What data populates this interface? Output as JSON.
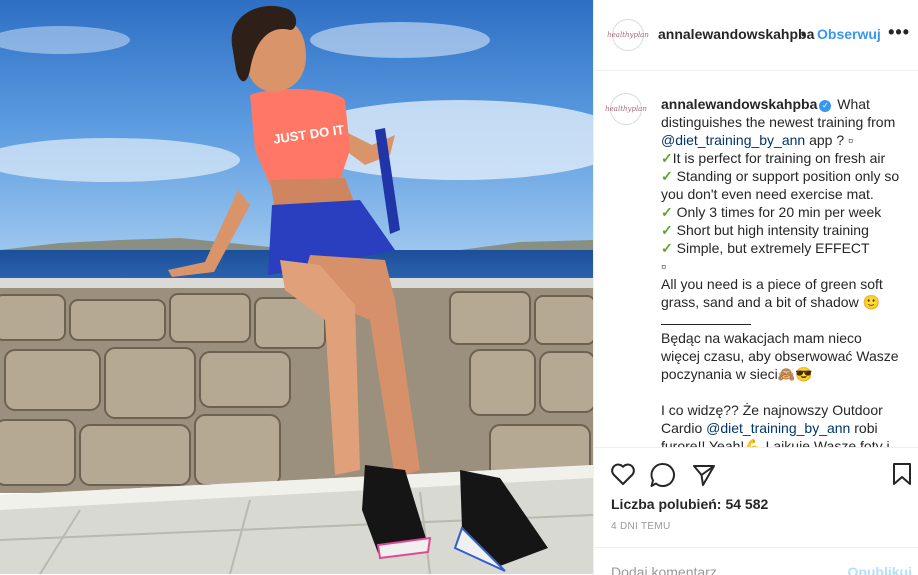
{
  "post": {
    "username": "annalewandowskahpba",
    "separator": "•",
    "follow_label": "Obserwuj",
    "more_label": "•••",
    "avatar_text": "healthyplan"
  },
  "caption": {
    "username": "annalewandowskahpba",
    "line1": "What distinguishes the newest training from",
    "mention1": "@diet_training_by_ann",
    "line1b": "app ? ▫",
    "bullets": [
      "It is perfect for training on fresh air",
      "Standing or support position only so you don't even need exercise mat.",
      "Only 3 times for 20 min per week",
      "Short but high intensity training",
      "Simple, but extremely EFFECT"
    ],
    "square": "▫",
    "line2": "All you need is a piece of green soft grass, sand and a bit of shadow 🙂",
    "pl1": "Będąc na wakacjach mam nieco więcej czasu, aby obserwować Wasze poczynania w sieci🙈😎",
    "pl2a": "I co widzę?? Że najnowszy Outdoor Cardio",
    "mention2": "@diet_training_by_ann",
    "pl2b": "robi furorę!! Yeah!💪 Lajkuję Wasze foty i"
  },
  "actions": {
    "likes_label": "Liczba polubień:",
    "likes_count": "54 582",
    "time_ago": "4 DNI TEMU"
  },
  "comment": {
    "placeholder": "Dodaj komentarz...",
    "post_label": "Opublikuj"
  },
  "icons": [
    "heart-icon",
    "comment-icon",
    "share-icon",
    "bookmark-icon",
    "verified-badge-icon",
    "checkmark-icon"
  ],
  "colors": {
    "link": "#3897f0",
    "mention": "#003569",
    "check": "#5ba829",
    "muted": "#999999"
  }
}
